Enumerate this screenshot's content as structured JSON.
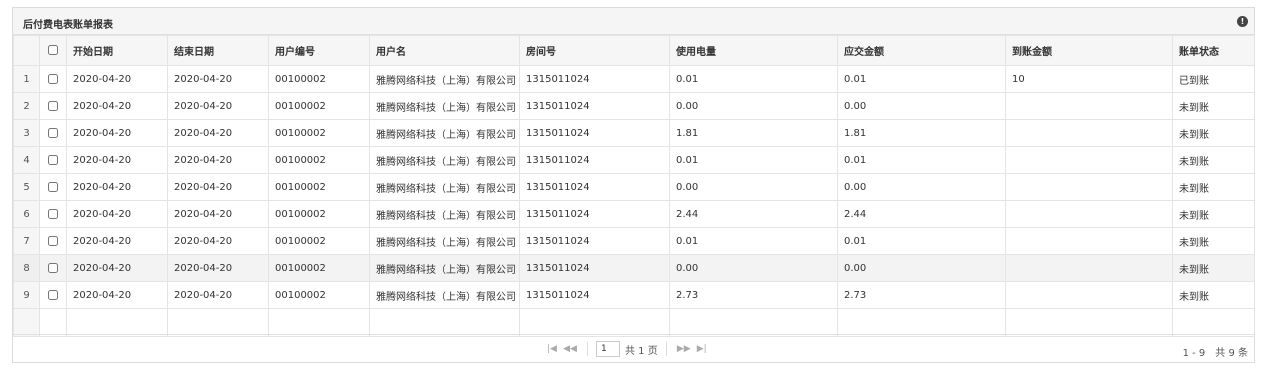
{
  "panel": {
    "title": "后付费电表账单报表",
    "info_icon": "info-icon"
  },
  "columns": [
    "开始日期",
    "结束日期",
    "用户编号",
    "用户名",
    "房间号",
    "使用电量",
    "应交金额",
    "到账金额",
    "账单状态"
  ],
  "rows": [
    {
      "n": "1",
      "start": "2020-04-20",
      "end": "2020-04-20",
      "uid": "00100002",
      "uname": "雅腾网络科技（上海）有限公司",
      "room": "1315011024",
      "usage": "0.01",
      "due": "0.01",
      "paid": "10",
      "status": "已到账"
    },
    {
      "n": "2",
      "start": "2020-04-20",
      "end": "2020-04-20",
      "uid": "00100002",
      "uname": "雅腾网络科技（上海）有限公司",
      "room": "1315011024",
      "usage": "0.00",
      "due": "0.00",
      "paid": "",
      "status": "未到账"
    },
    {
      "n": "3",
      "start": "2020-04-20",
      "end": "2020-04-20",
      "uid": "00100002",
      "uname": "雅腾网络科技（上海）有限公司",
      "room": "1315011024",
      "usage": "1.81",
      "due": "1.81",
      "paid": "",
      "status": "未到账"
    },
    {
      "n": "4",
      "start": "2020-04-20",
      "end": "2020-04-20",
      "uid": "00100002",
      "uname": "雅腾网络科技（上海）有限公司",
      "room": "1315011024",
      "usage": "0.01",
      "due": "0.01",
      "paid": "",
      "status": "未到账"
    },
    {
      "n": "5",
      "start": "2020-04-20",
      "end": "2020-04-20",
      "uid": "00100002",
      "uname": "雅腾网络科技（上海）有限公司",
      "room": "1315011024",
      "usage": "0.00",
      "due": "0.00",
      "paid": "",
      "status": "未到账"
    },
    {
      "n": "6",
      "start": "2020-04-20",
      "end": "2020-04-20",
      "uid": "00100002",
      "uname": "雅腾网络科技（上海）有限公司",
      "room": "1315011024",
      "usage": "2.44",
      "due": "2.44",
      "paid": "",
      "status": "未到账"
    },
    {
      "n": "7",
      "start": "2020-04-20",
      "end": "2020-04-20",
      "uid": "00100002",
      "uname": "雅腾网络科技（上海）有限公司",
      "room": "1315011024",
      "usage": "0.01",
      "due": "0.01",
      "paid": "",
      "status": "未到账"
    },
    {
      "n": "8",
      "start": "2020-04-20",
      "end": "2020-04-20",
      "uid": "00100002",
      "uname": "雅腾网络科技（上海）有限公司",
      "room": "1315011024",
      "usage": "0.00",
      "due": "0.00",
      "paid": "",
      "status": "未到账"
    },
    {
      "n": "9",
      "start": "2020-04-20",
      "end": "2020-04-20",
      "uid": "00100002",
      "uname": "雅腾网络科技（上海）有限公司",
      "room": "1315011024",
      "usage": "2.73",
      "due": "2.73",
      "paid": "",
      "status": "未到账"
    }
  ],
  "pager": {
    "first_icon": "first-page-icon",
    "prev_icon": "prev-page-icon",
    "next_icon": "next-page-icon",
    "last_icon": "last-page-icon",
    "page_value": "1",
    "total_pages": "共 1 页",
    "summary": "1 - 9　共 9 条"
  }
}
